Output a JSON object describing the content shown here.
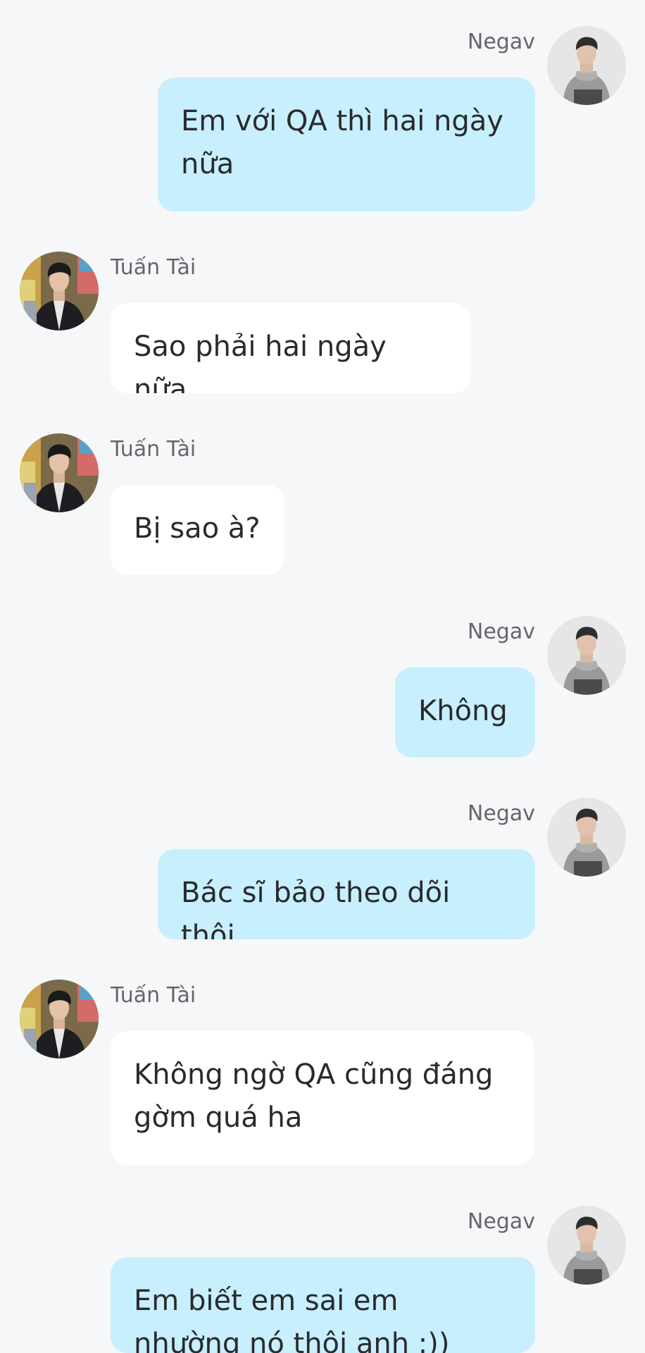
{
  "messages": [
    {
      "side": "right",
      "sender": "Negav",
      "text": "Em với QA thì hai ngày nữa",
      "avatar": "negav-avatar"
    },
    {
      "side": "left",
      "sender": "Tuấn Tài",
      "text": "Sao phải hai ngày nữa",
      "avatar": "tuan-tai-avatar"
    },
    {
      "side": "left",
      "sender": "Tuấn Tài",
      "text": "Bị sao à?",
      "avatar": "tuan-tai-avatar"
    },
    {
      "side": "right",
      "sender": "Negav",
      "text": "Không",
      "avatar": "negav-avatar"
    },
    {
      "side": "right",
      "sender": "Negav",
      "text": "Bác sĩ bảo theo dõi thôi",
      "avatar": "negav-avatar"
    },
    {
      "side": "left",
      "sender": "Tuấn Tài",
      "text": "Không ngờ QA cũng đáng gờm quá ha",
      "avatar": "tuan-tai-avatar"
    },
    {
      "side": "right",
      "sender": "Negav",
      "text": "Em biết em sai em nhường nó thôi anh :))",
      "avatar": "negav-avatar"
    }
  ],
  "colors": {
    "background": "#f6f7f9",
    "outgoing_bubble": "#c7effd",
    "incoming_bubble": "#ffffff",
    "text": "#2a2a2e",
    "sender_name": "#66666a"
  }
}
